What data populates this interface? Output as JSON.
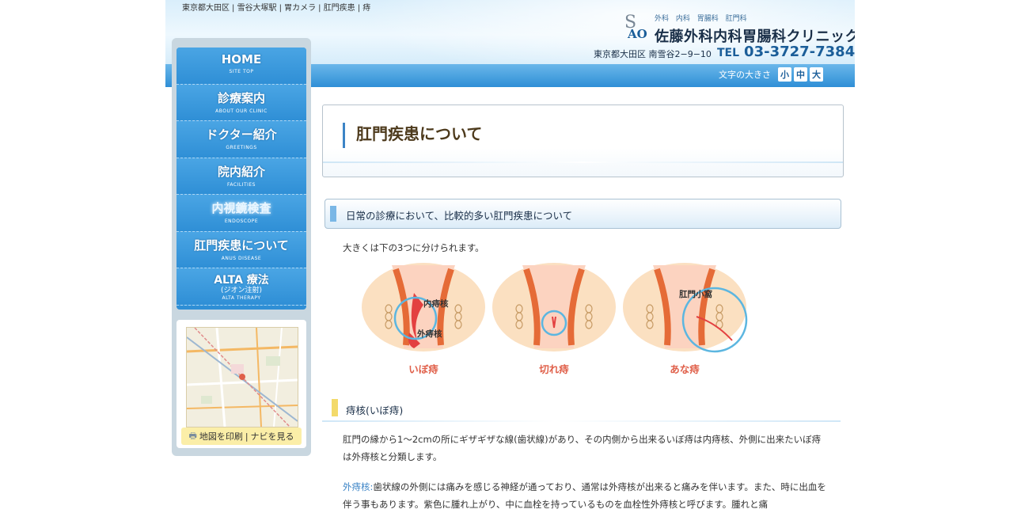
{
  "header": {
    "breadcrumb": [
      "東京都大田区",
      "雪谷大塚駅",
      "胃カメラ",
      "肛門疾患",
      "痔"
    ],
    "logo_mark_s": "S",
    "logo_mark_ao": "AO",
    "departments": "外科 内科 胃腸科 肛門科",
    "clinic_name": "佐藤外科内科胃腸科クリニック",
    "address": "東京都大田区 南雪谷2−9−10",
    "tel_label": "TEL",
    "tel_number": "03-3727-7384",
    "font_size_label": "文字の大きさ",
    "font_sizes": [
      "小",
      "中",
      "大"
    ]
  },
  "nav": [
    {
      "ja": "HOME",
      "en": "SITE TOP"
    },
    {
      "ja": "診療案内",
      "en": "ABOUT OUR CLINIC"
    },
    {
      "ja": "ドクター紹介",
      "en": "GREETINGS"
    },
    {
      "ja": "院内紹介",
      "en": "FACILITIES"
    },
    {
      "ja": "内視鏡検査",
      "en": "ENDOSCOPE"
    },
    {
      "ja": "肛門疾患について",
      "en": "ANUS DISEASE"
    },
    {
      "ja": "ALTA 療法",
      "sub": "(ジオン注射)",
      "en": "ALTA THERAPY"
    }
  ],
  "map": {
    "print_label": "地図を印刷",
    "separator": "|",
    "navi_label": "ナビを見る"
  },
  "main": {
    "page_title": "肛門疾患について",
    "section1_title": "日常の診療において、比較的多い肛門疾患について",
    "intro": "大きくは下の3つに分けられます。",
    "diagrams": [
      {
        "label": "いぼ痔",
        "annotations": [
          "内痔核",
          "外痔核"
        ]
      },
      {
        "label": "切れ痔",
        "annotations": []
      },
      {
        "label": "あな痔",
        "annotations": [
          "肛門小窩"
        ]
      }
    ],
    "section2_title": "痔核(いぼ痔)",
    "paragraph1": "肛門の縁から1〜2cmの所にギザギザな線(歯状線)があり、その内側から出来るいぼ痔は内痔核、外側に出来たいぼ痔は外痔核と分類します。",
    "paragraph2_keyword": "外痔核:",
    "paragraph2": "歯状線の外側には痛みを感じる神経が通っており、通常は外痔核が出来ると痛みを伴います。また、時に出血を伴う事もあります。紫色に腫れ上がり、中に血栓を持っているものを血栓性外痔核と呼びます。腫れと痛"
  },
  "colors": {
    "accent_blue": "#2f8fd6",
    "title_brown": "#4d3a1c",
    "diagram_label_red": "#e0604a",
    "section_yellow": "#f3da6a"
  }
}
